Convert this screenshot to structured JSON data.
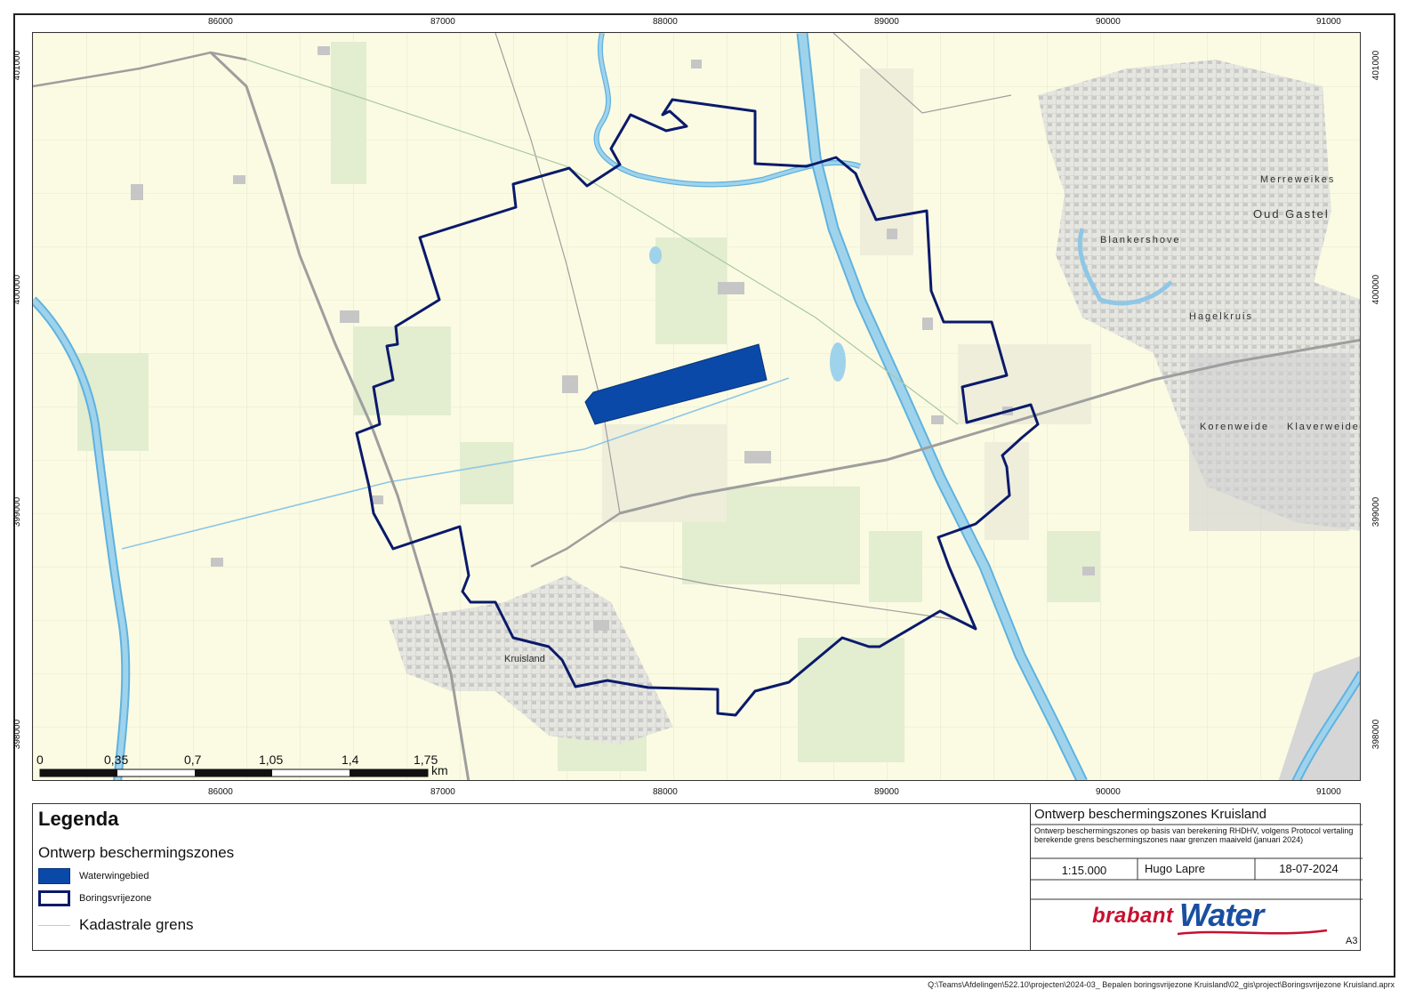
{
  "map": {
    "x_ticks": [
      "86000",
      "87000",
      "88000",
      "89000",
      "90000",
      "91000"
    ],
    "y_ticks": [
      "401000",
      "400000",
      "399000",
      "398000"
    ],
    "place_labels": {
      "merreweikes": "Merreweikes",
      "oud_gastel": "Oud Gastel",
      "blankershove": "Blankershove",
      "hagelkruis": "Hagelkruis",
      "korenweide": "Korenweide",
      "klaverweide": "Klaverweide",
      "kruisland": "Kruisland"
    },
    "scalebar": {
      "labels": [
        "0",
        "0,35",
        "0,7",
        "1,05",
        "1,4",
        "1,75"
      ],
      "unit": "km"
    },
    "colors": {
      "background": "#fbfbe3",
      "water": "#9fd3ec",
      "water_edge": "#5fb2df",
      "green_field": "#e3edcf",
      "built": "#d3d3d3",
      "road": "#9e9e9e",
      "boundary": "#0a1a6b",
      "waterwingebied": "#0a49a8"
    }
  },
  "legend": {
    "title": "Legenda",
    "subtitle": "Ontwerp beschermingszones",
    "items": [
      {
        "label": "Waterwingebied",
        "type": "fill"
      },
      {
        "label": "Boringsvrijezone",
        "type": "outline"
      },
      {
        "label": "Kadastrale grens",
        "type": "line"
      }
    ]
  },
  "title_block": {
    "title": "Ontwerp beschermingszones Kruisland",
    "description": "Ontwerp beschermingszones op basis van berekening RHDHV, volgens Protocol vertaling berekende grens beschermingszones naar grenzen maaiveld (januari 2024)",
    "scale": "1:15.000",
    "author": "Hugo Lapre",
    "date": "18-07-2024",
    "logo_brabant": "brabant",
    "logo_water": "Water",
    "sheet": "A3"
  },
  "file_path": "Q:\\Teams\\Afdelingen\\522.10\\projecten\\2024-03_ Bepalen boringsvrijezone Kruisland\\02_gis\\project\\Boringsvrijezone Kruisland.aprx"
}
